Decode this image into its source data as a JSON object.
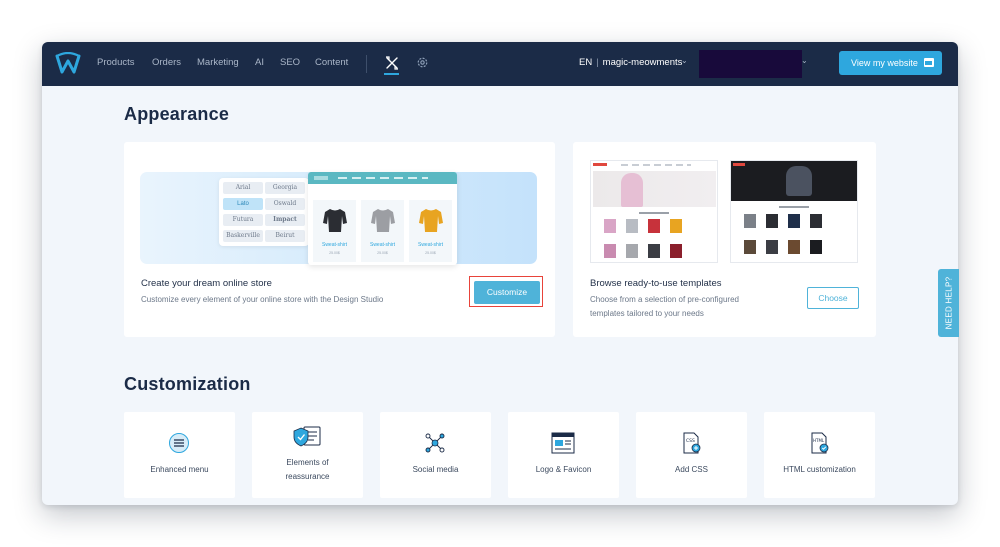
{
  "topbar": {
    "nav": [
      "Products",
      "Orders",
      "Marketing",
      "AI",
      "SEO",
      "Content"
    ],
    "language": "EN",
    "store_name": "magic-meowments",
    "view_website_label": "View my website"
  },
  "appearance": {
    "title": "Appearance",
    "customize_card": {
      "title": "Create your dream online store",
      "description": "Customize every element of your online store with the Design Studio",
      "button_label": "Customize",
      "fonts": [
        "Arial",
        "Georgia",
        "Lato",
        "Oswald",
        "Futura",
        "Impact",
        "Baskerville",
        "Beirut"
      ],
      "products": [
        {
          "name": "Sweat-shirt",
          "price": "25.00$"
        },
        {
          "name": "Sweat-shirt",
          "price": "25.00$"
        },
        {
          "name": "Sweat-shirt",
          "price": "25.00$"
        }
      ]
    },
    "templates_card": {
      "title": "Browse ready-to-use templates",
      "description_line1": "Choose from a selection of pre-configured",
      "description_line2": "templates tailored to your needs",
      "button_label": "Choose"
    }
  },
  "customization": {
    "title": "Customization",
    "tiles": [
      {
        "line1": "Enhanced menu",
        "line2": "",
        "icon": "menu-icon"
      },
      {
        "line1": "Elements of",
        "line2": "reassurance",
        "icon": "shield-check-icon"
      },
      {
        "line1": "Social media",
        "line2": "",
        "icon": "network-icon"
      },
      {
        "line1": "Logo & Favicon",
        "line2": "",
        "icon": "browser-window-icon"
      },
      {
        "line1": "Add CSS",
        "line2": "",
        "icon": "css-file-icon"
      },
      {
        "line1": "HTML customization",
        "line2": "",
        "icon": "html-file-icon"
      }
    ]
  },
  "help": {
    "label": "NEED HELP?"
  },
  "colors": {
    "topbar": "#1b2b47",
    "accent": "#2ea7de",
    "highlight": "#e8433a",
    "background": "#f2f6fb"
  }
}
